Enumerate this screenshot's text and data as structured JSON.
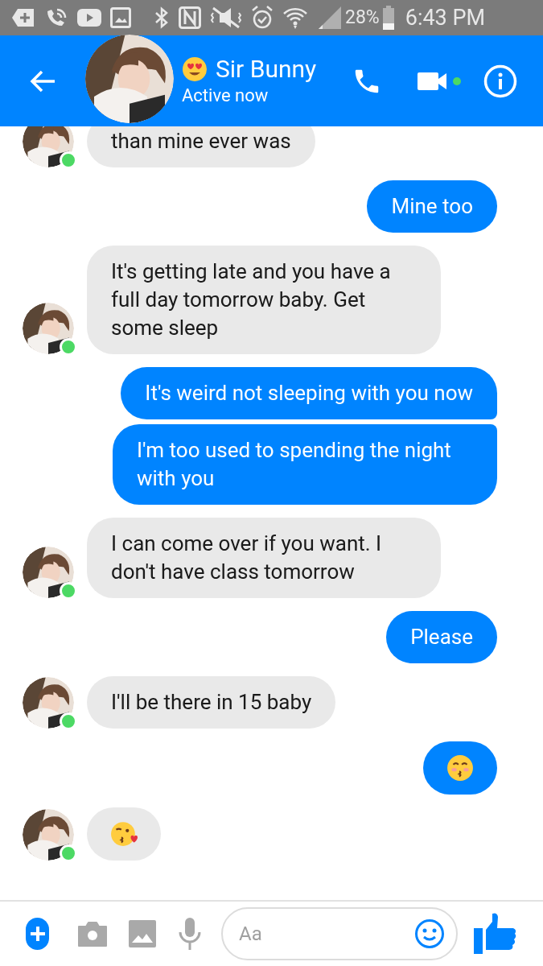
{
  "status_bar": {
    "battery": "28%",
    "time": "6:43 PM"
  },
  "header": {
    "name": "Sir Bunny",
    "status": "Active now",
    "video_online": true
  },
  "messages": [
    {
      "sent": false,
      "kind": "text",
      "text": "than mine ever was"
    },
    {
      "sent": true,
      "kind": "text",
      "text": "Mine too"
    },
    {
      "sent": false,
      "kind": "text",
      "text": "It's getting late and you have a full day tomorrow baby. Get some sleep"
    },
    {
      "sent": true,
      "kind": "text",
      "text": "It's weird not sleeping with you now"
    },
    {
      "sent": true,
      "kind": "text",
      "text": "I'm too used to spending the night with you"
    },
    {
      "sent": false,
      "kind": "text",
      "text": "I can come over if you want. I don't have class tomorrow"
    },
    {
      "sent": true,
      "kind": "text",
      "text": "Please"
    },
    {
      "sent": false,
      "kind": "text",
      "text": "I'll be there in 15 baby"
    },
    {
      "sent": true,
      "kind": "emoji"
    },
    {
      "sent": false,
      "kind": "emoji"
    }
  ],
  "composer": {
    "placeholder": "Aa"
  }
}
